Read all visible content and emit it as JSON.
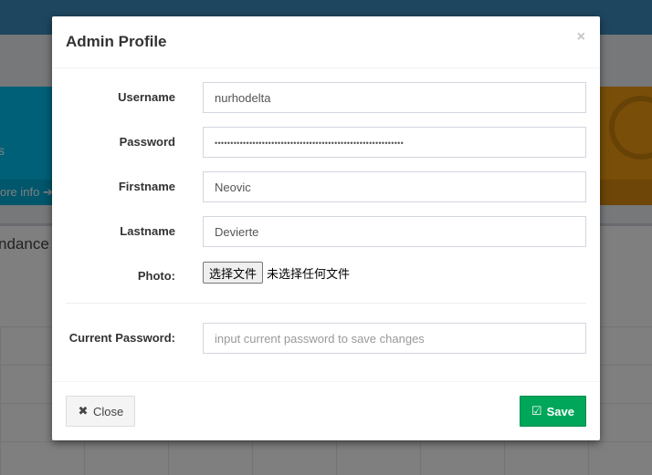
{
  "background": {
    "info_box_text": "s",
    "info_box_footer": "ore info",
    "panel_title": "ndance R"
  },
  "modal": {
    "title": "Admin Profile",
    "close_symbol": "×",
    "fields": {
      "username": {
        "label": "Username",
        "value": "nurhodelta"
      },
      "password": {
        "label": "Password",
        "value": "••••••••••••••••••••••••••••••••••••••••••••••••••••••••••••"
      },
      "firstname": {
        "label": "Firstname",
        "value": "Neovic"
      },
      "lastname": {
        "label": "Lastname",
        "value": "Devierte"
      },
      "photo": {
        "label": "Photo:",
        "button_label": "选择文件",
        "status": "未选择任何文件"
      },
      "current_password": {
        "label": "Current Password:",
        "placeholder": "input current password to save changes"
      }
    },
    "footer": {
      "close_label": "Close",
      "save_label": "Save"
    }
  },
  "colors": {
    "primary": "#3c8dbc",
    "success": "#00a65a",
    "info": "#00c0ef",
    "warning": "#f39c12"
  }
}
